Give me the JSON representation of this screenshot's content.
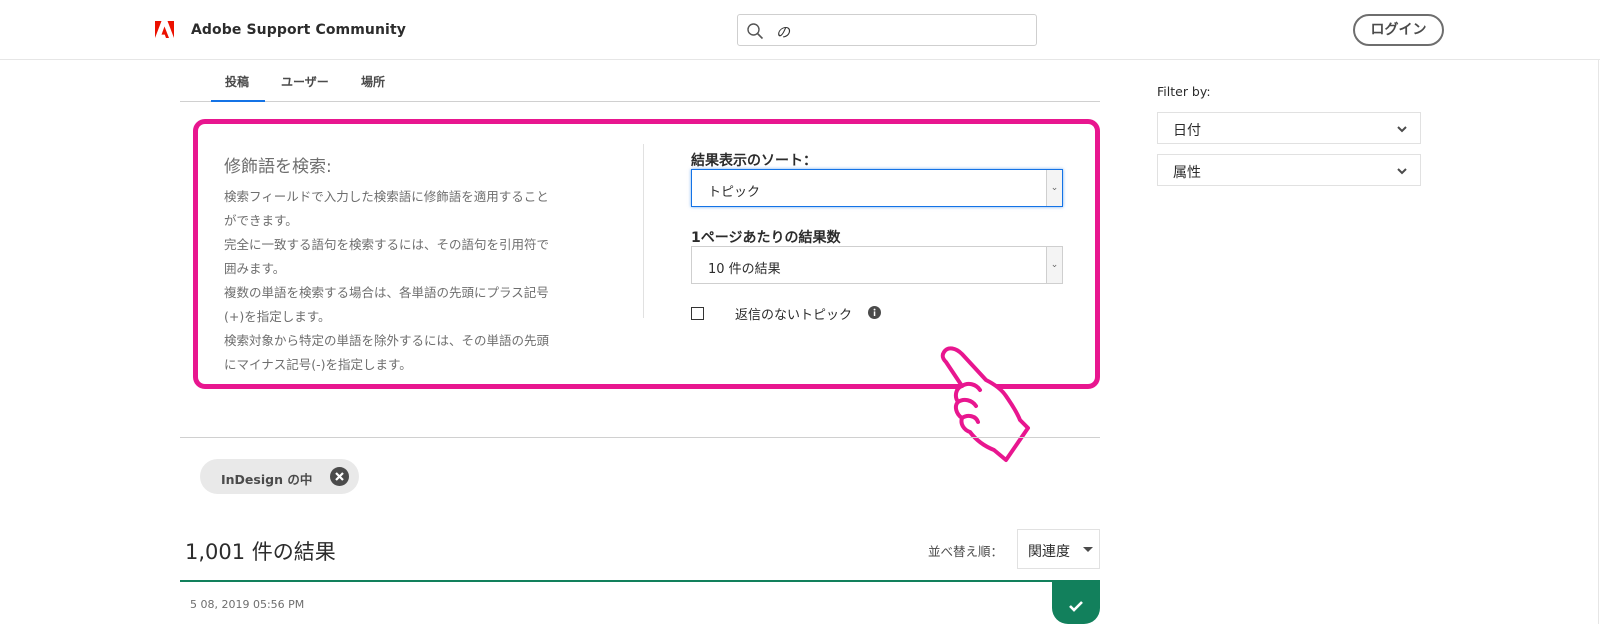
{
  "header": {
    "brand": "Adobe Support Community",
    "search_value": "の",
    "login_label": "ログイン"
  },
  "tabs": [
    {
      "label": "投稿",
      "active": true
    },
    {
      "label": "ユーザー",
      "active": false
    },
    {
      "label": "場所",
      "active": false
    }
  ],
  "search_options": {
    "help_title": "修飾語を検索:",
    "help_lines": [
      "検索フィールドで入力した検索語に修飾語を適用すること",
      "ができます。",
      "完全に一致する語句を検索するには、その語句を引用符で",
      "囲みます。",
      "複数の単語を検索する場合は、各単語の先頭にプラス記号",
      "(+)を指定します。",
      "検索対象から特定の単語を除外するには、その単語の先頭",
      "にマイナス記号(-)を指定します。"
    ],
    "sort_label": "結果表示のソート：",
    "sort_value": "トピック",
    "per_page_label": "1ページあたりの結果数",
    "per_page_value": "10 件の結果",
    "no_reply_label": "返信のないトピック"
  },
  "filter_chip": {
    "label": "InDesign の中"
  },
  "results": {
    "count_text": "1,001 件の結果",
    "sort_by_label": "並べ替え順：",
    "sort_by_value": "関連度"
  },
  "first_post": {
    "date": "5 08, 2019 05:56 PM"
  },
  "sidebar": {
    "filter_title": "Filter by:",
    "facets": [
      {
        "label": "日付"
      },
      {
        "label": "属性"
      }
    ]
  },
  "colors": {
    "highlight_pink": "#e8168f",
    "accent_blue": "#1473e6",
    "solved_green": "#12805c",
    "adobe_red": "#eb1000"
  }
}
